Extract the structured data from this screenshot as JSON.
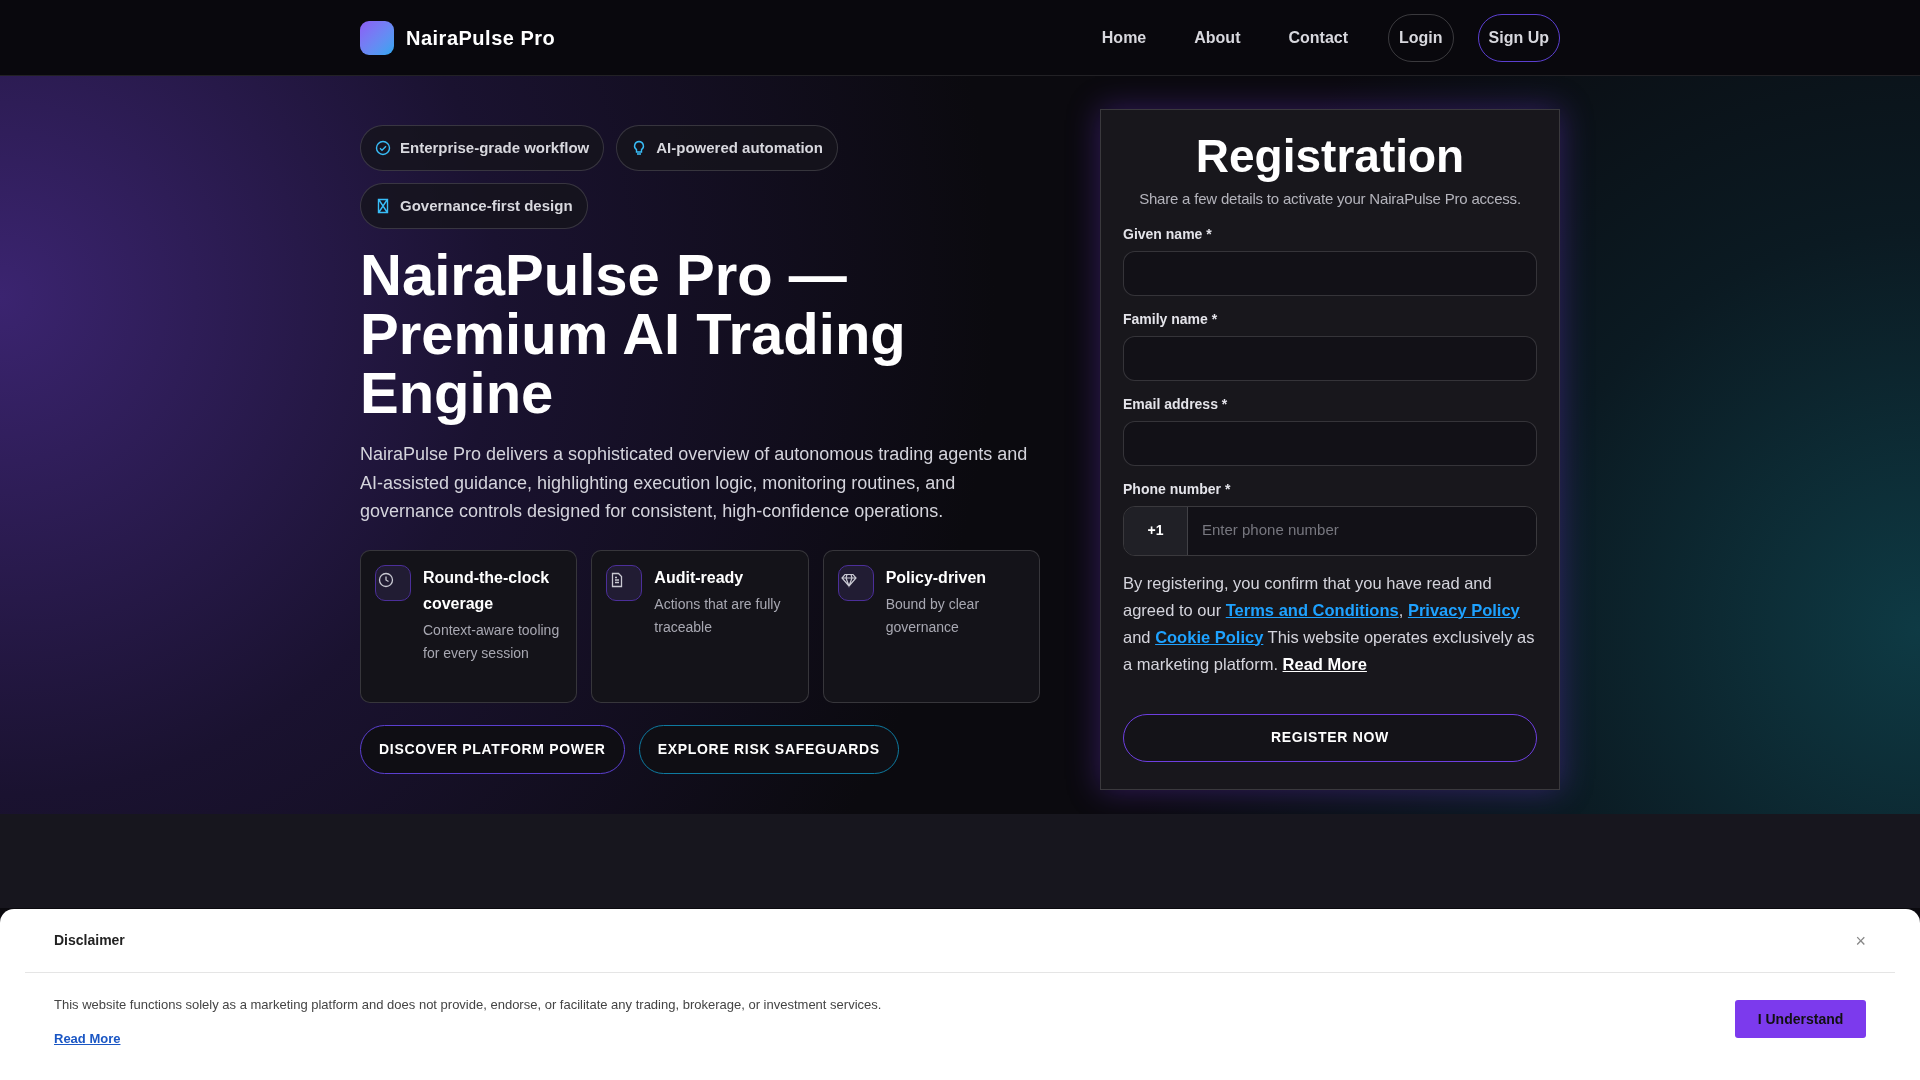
{
  "header": {
    "brand": "NairaPulse Pro",
    "nav": [
      {
        "label": "Home",
        "kind": "link"
      },
      {
        "label": "About",
        "kind": "link"
      },
      {
        "label": "Contact",
        "kind": "link"
      },
      {
        "label": "Login",
        "kind": "outline"
      },
      {
        "label": "Sign Up",
        "kind": "accent"
      }
    ]
  },
  "hero": {
    "badges": [
      {
        "label": "Enterprise-grade workflow",
        "kind": "check"
      },
      {
        "label": "AI-powered automation",
        "kind": "bulb"
      },
      {
        "label": "Governance-first design",
        "kind": "hourglass"
      }
    ],
    "title": "NairaPulse Pro — Premium AI Trading Engine",
    "description": "NairaPulse Pro delivers a sophisticated overview of autonomous trading agents and AI-assisted guidance, highlighting execution logic, monitoring routines, and governance controls designed for consistent, high-confidence operations.",
    "features": [
      {
        "kind": "clock",
        "title": "Round-the-clock coverage",
        "text": "Context-aware tooling for every session"
      },
      {
        "kind": "document",
        "title": "Audit-ready",
        "text": "Actions that are fully traceable"
      },
      {
        "kind": "diamond",
        "title": "Policy-driven",
        "text": "Bound by clear governance"
      }
    ],
    "buttons": [
      {
        "label": "DISCOVER PLATFORM POWER",
        "kind": "violet"
      },
      {
        "label": "EXPLORE RISK SAFEGUARDS",
        "kind": "cyan"
      }
    ]
  },
  "registration": {
    "title": "Registration",
    "subtitle": "Share a few details to activate your NairaPulse Pro access.",
    "fields": [
      {
        "label": "Given name *",
        "kind": "text"
      },
      {
        "label": "Family name *",
        "kind": "text"
      },
      {
        "label": "Email address *",
        "kind": "text"
      },
      {
        "label": "Phone number *",
        "kind": "phone",
        "prefix": "+1",
        "placeholder": "Enter phone number"
      }
    ],
    "consent": [
      {
        "kind": "text",
        "text": "By registering, you confirm that you have read and agreed to our "
      },
      {
        "kind": "link",
        "text": "Terms and Conditions"
      },
      {
        "kind": "text",
        "text": ", "
      },
      {
        "kind": "link",
        "text": "Privacy Policy"
      },
      {
        "kind": "text",
        "text": " and "
      },
      {
        "kind": "link",
        "text": "Cookie Policy"
      },
      {
        "kind": "text",
        "text": " This website operates exclusively as a marketing platform. "
      },
      {
        "kind": "more",
        "text": "Read More"
      }
    ],
    "submit": "REGISTER NOW"
  },
  "disclaimer": {
    "title": "Disclaimer",
    "close": "×",
    "text": "This website functions solely as a marketing platform and does not provide, endorse, or facilitate any trading, brokerage, or investment services.",
    "link": "Read More",
    "button": "I Understand"
  }
}
